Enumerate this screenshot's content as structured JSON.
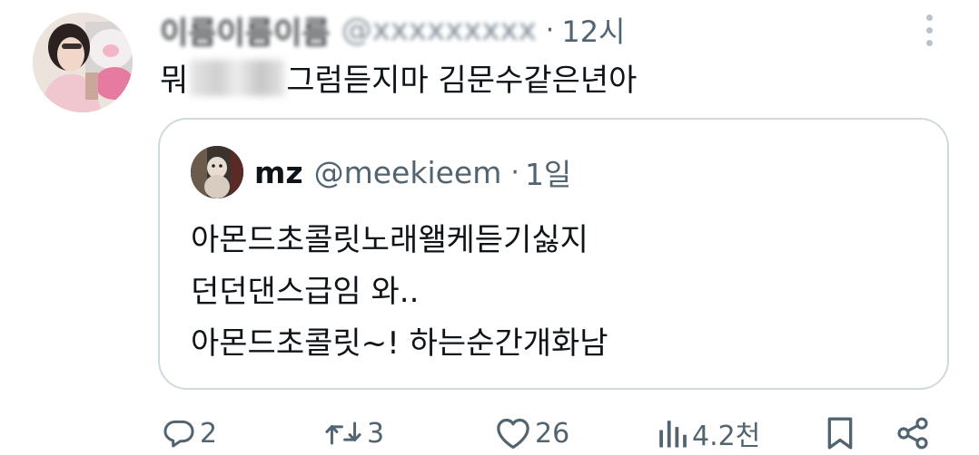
{
  "tweet": {
    "time": "12시",
    "separator": "·",
    "text_start": "뭐",
    "text_end": "그럼듣지마 김문수같은년아"
  },
  "quote": {
    "display_name": "mz",
    "handle": "@meekieem",
    "separator": "·",
    "time": "1일",
    "lines": [
      "아몬드초콜릿노래왤케듣기싫지",
      "던던댄스급임 와..",
      "아몬드초콜릿~! 하는순간개화남"
    ]
  },
  "actions": {
    "replies": "2",
    "retweets": "3",
    "likes": "26",
    "views": "4.2천"
  },
  "icons": {
    "reply": "reply-icon",
    "retweet": "retweet-icon",
    "like": "heart-icon",
    "views": "views-icon",
    "bookmark": "bookmark-icon",
    "share": "share-icon",
    "more": "more-vertical-icon"
  },
  "colors": {
    "text": "#0f1419",
    "secondary": "#536471",
    "border": "#cfd9de"
  }
}
